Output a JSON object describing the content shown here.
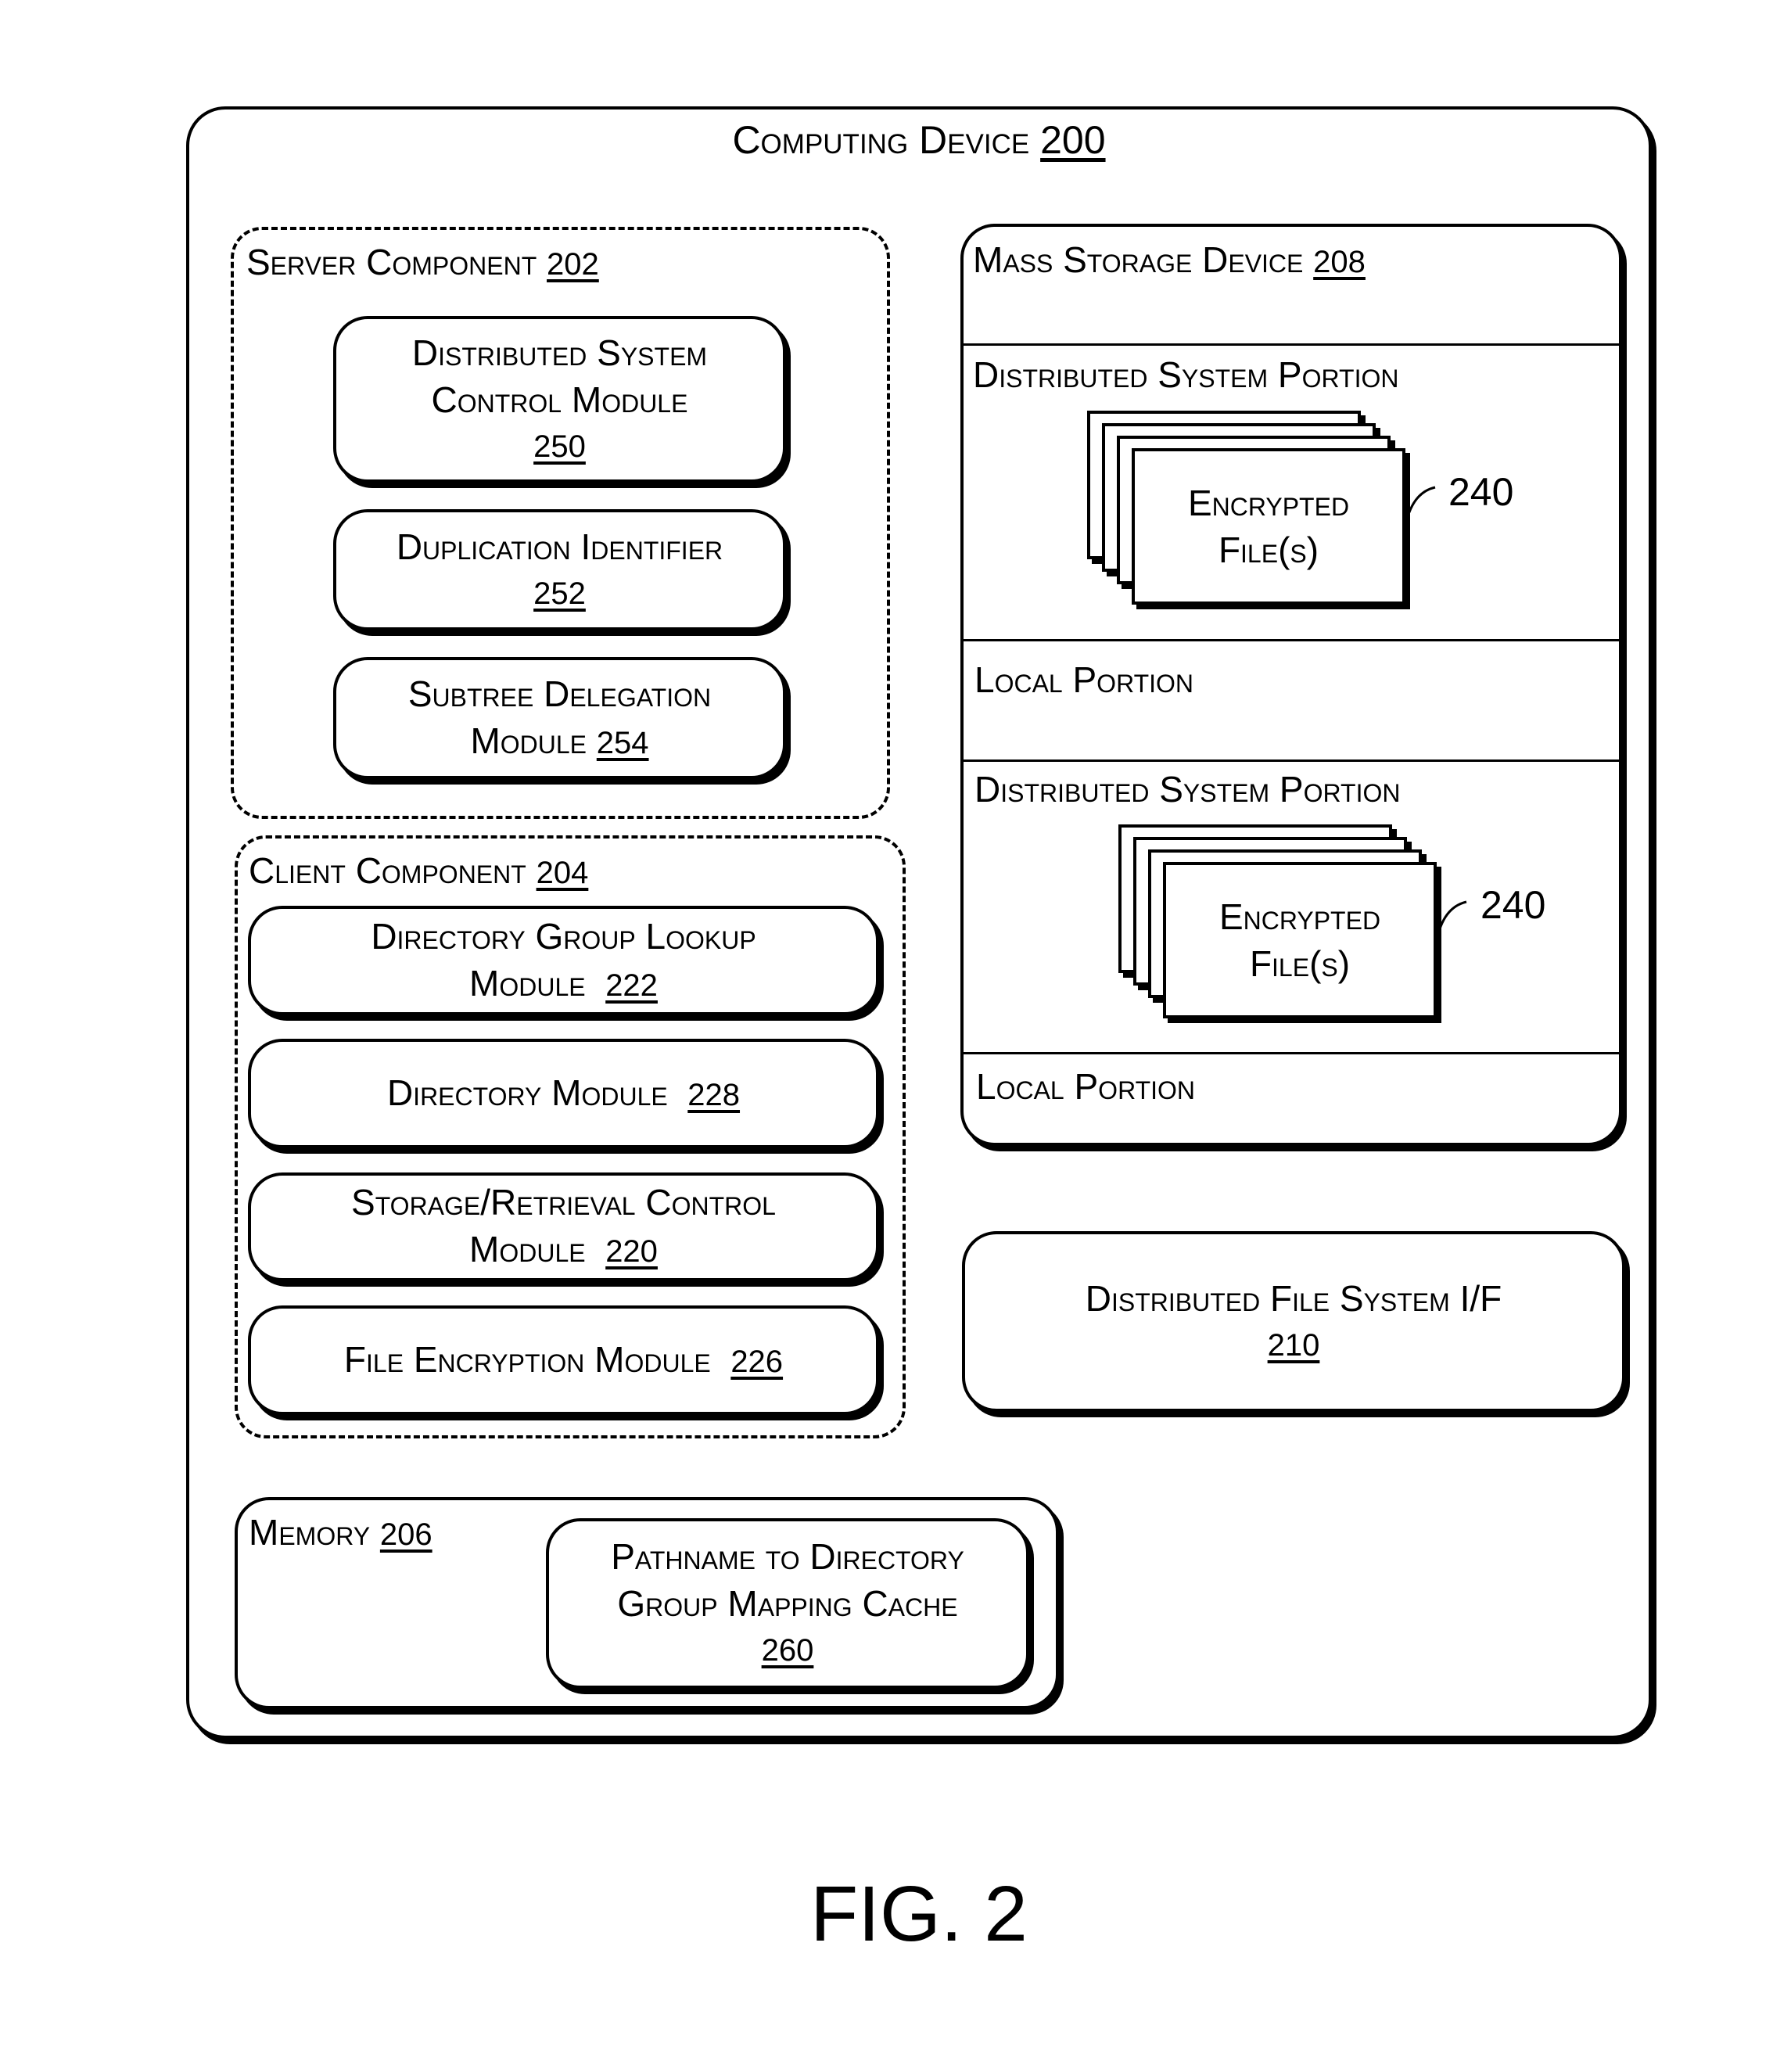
{
  "figure_label": "FIG. 2",
  "computing_device": {
    "title": "Computing Device",
    "ref": "200"
  },
  "server_component": {
    "title": "Server Component",
    "ref": "202",
    "modules": [
      {
        "line1": "Distributed System",
        "line2": "Control Module",
        "ref": "250"
      },
      {
        "line1": "Duplication Identifier",
        "line2": "",
        "ref": "252"
      },
      {
        "line1": "Subtree Delegation",
        "line2": "Module",
        "ref": "254"
      }
    ]
  },
  "client_component": {
    "title": "Client Component",
    "ref": "204",
    "modules": [
      {
        "line1": "Directory Group Lookup",
        "line2": "Module",
        "ref": "222"
      },
      {
        "line1": "Directory Module",
        "line2": "",
        "ref": "228"
      },
      {
        "line1": "Storage/Retrieval Control",
        "line2": "Module",
        "ref": "220"
      },
      {
        "line1": "File Encryption Module",
        "line2": "",
        "ref": "226"
      }
    ]
  },
  "memory": {
    "title": "Memory",
    "ref": "206",
    "cache": {
      "line1": "Pathname to Directory",
      "line2": "Group Mapping Cache",
      "ref": "260"
    }
  },
  "mass_storage": {
    "title": "Mass Storage Device",
    "ref": "208",
    "sections": [
      {
        "label": "Distributed System Portion",
        "files_line1": "Encrypted",
        "files_line2": "File(s)",
        "files_ref": "240"
      },
      {
        "label": "Local Portion"
      },
      {
        "label": "Distributed System Portion",
        "files_line1": "Encrypted",
        "files_line2": "File(s)",
        "files_ref": "240"
      },
      {
        "label": "Local Portion"
      }
    ]
  },
  "dfs_interface": {
    "title": "Distributed File System I/F",
    "ref": "210"
  }
}
